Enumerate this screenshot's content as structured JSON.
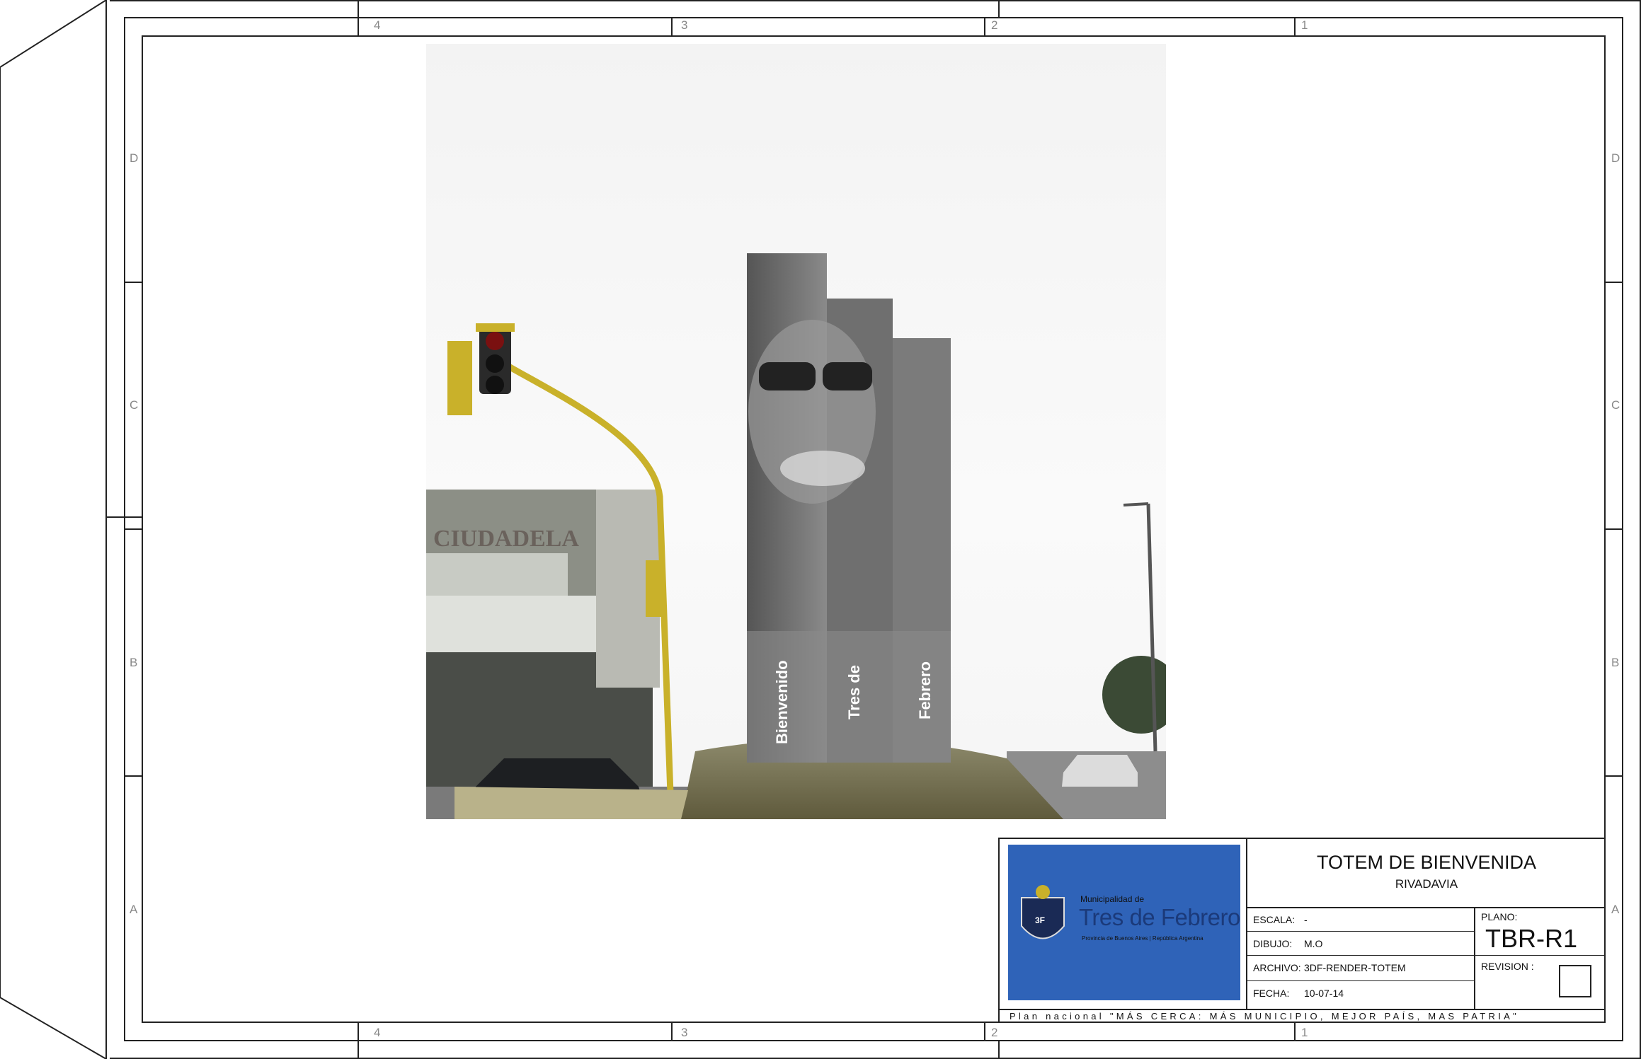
{
  "frame": {
    "column_labels": [
      "4",
      "3",
      "2",
      "1"
    ],
    "row_labels": [
      "D",
      "C",
      "B",
      "A"
    ]
  },
  "render": {
    "totem_words": [
      "Bienvenido",
      "Tres de",
      "Febrero"
    ],
    "building_sign": "CIUDADELA"
  },
  "logo": {
    "line1": "Municipalidad de",
    "line2": "Tres de Febrero",
    "line3": "Provincia de Buenos Aires | República Argentina",
    "shield_text": "3F",
    "bg_color": "#2f63b8"
  },
  "title_block": {
    "title": "TOTEM DE BIENVENIDA",
    "subtitle": "RIVADAVIA",
    "fields": [
      {
        "label": "ESCALA:",
        "value": "-"
      },
      {
        "label": "DIBUJO:",
        "value": "M.O"
      },
      {
        "label": "ARCHIVO:",
        "value": "3DF-RENDER-TOTEM"
      },
      {
        "label": "FECHA:",
        "value": "10-07-14"
      }
    ],
    "plano_label": "PLANO:",
    "plano_value": "TBR-R1",
    "revision_label": "REVISION :",
    "footer": "Plan nacional \"MÁS CERCA: MÁS MUNICIPIO, MEJOR PAÍS, MAS PATRIA\""
  }
}
